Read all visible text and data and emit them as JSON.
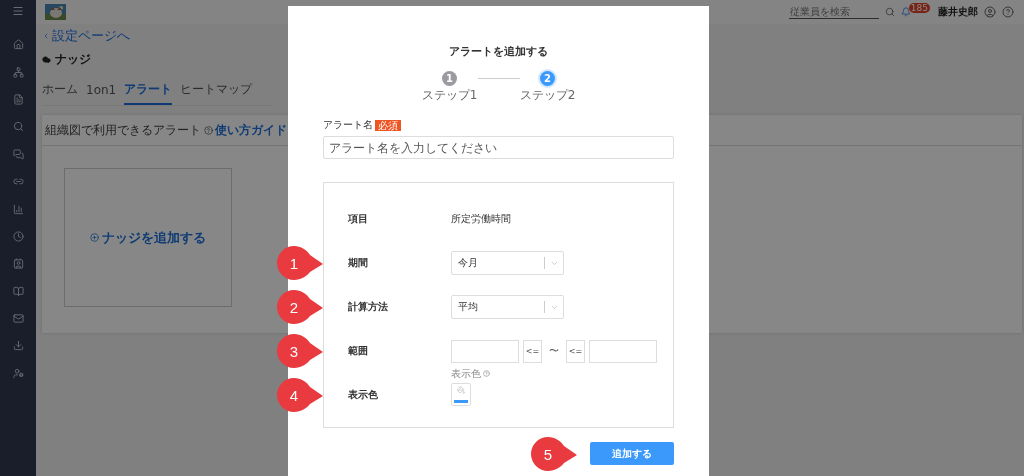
{
  "top_bar": {
    "search": {
      "placeholder": "従業員を検索"
    },
    "notification_count": "185",
    "user_name": "藤井史郎"
  },
  "page": {
    "back_link": "設定ページへ",
    "title": "ナッジ",
    "tabs": [
      {
        "label": "ホーム",
        "selected": false
      },
      {
        "label": "1on1",
        "selected": false
      },
      {
        "label": "アラート",
        "selected": true
      },
      {
        "label": "ヒートマップ",
        "selected": false
      }
    ],
    "card": {
      "title": "組織図で利用できるアラート",
      "guide_link": "使い方ガイド",
      "add_label": "ナッジを追加する"
    }
  },
  "dialog": {
    "title": "アラートを追加する",
    "steps": [
      {
        "number": "1",
        "label": "ステップ1",
        "selected": false
      },
      {
        "number": "2",
        "label": "ステップ2",
        "selected": true
      }
    ],
    "name_field": {
      "label": "アラート名",
      "required_badge": "必須",
      "placeholder": "アラート名を入力してください"
    },
    "item": {
      "label": "項目",
      "value": "所定労働時間"
    },
    "period": {
      "label": "期間",
      "value": "今月"
    },
    "method": {
      "label": "計算方法",
      "value": "平均"
    },
    "range": {
      "label": "範囲",
      "from_operator": "<=",
      "separator": "〜",
      "to_operator": "<="
    },
    "display_color": {
      "label": "表示色",
      "caption": "表示色",
      "color": "#3b99fc"
    },
    "submit": "追加する"
  },
  "callouts": [
    "1",
    "2",
    "3",
    "4",
    "5"
  ]
}
